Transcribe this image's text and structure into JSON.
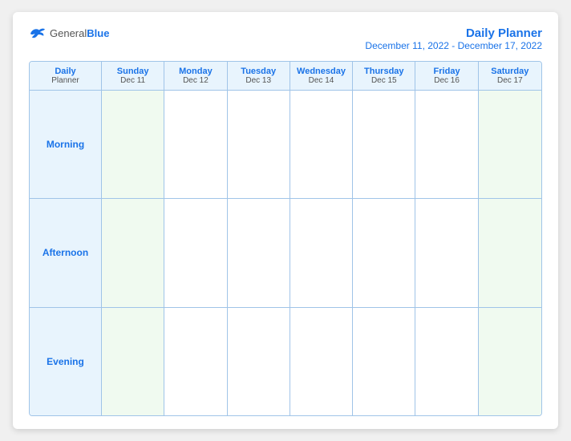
{
  "logo": {
    "general": "General",
    "blue": "Blue"
  },
  "title": {
    "main": "Daily Planner",
    "subtitle": "December 11, 2022 - December 17, 2022"
  },
  "header": {
    "label_line1": "Daily",
    "label_line2": "Planner",
    "days": [
      {
        "name": "Sunday",
        "date": "Dec 11"
      },
      {
        "name": "Monday",
        "date": "Dec 12"
      },
      {
        "name": "Tuesday",
        "date": "Dec 13"
      },
      {
        "name": "Wednesday",
        "date": "Dec 14"
      },
      {
        "name": "Thursday",
        "date": "Dec 15"
      },
      {
        "name": "Friday",
        "date": "Dec 16"
      },
      {
        "name": "Saturday",
        "date": "Dec 17"
      }
    ]
  },
  "rows": [
    {
      "label": "Morning"
    },
    {
      "label": "Afternoon"
    },
    {
      "label": "Evening"
    }
  ]
}
